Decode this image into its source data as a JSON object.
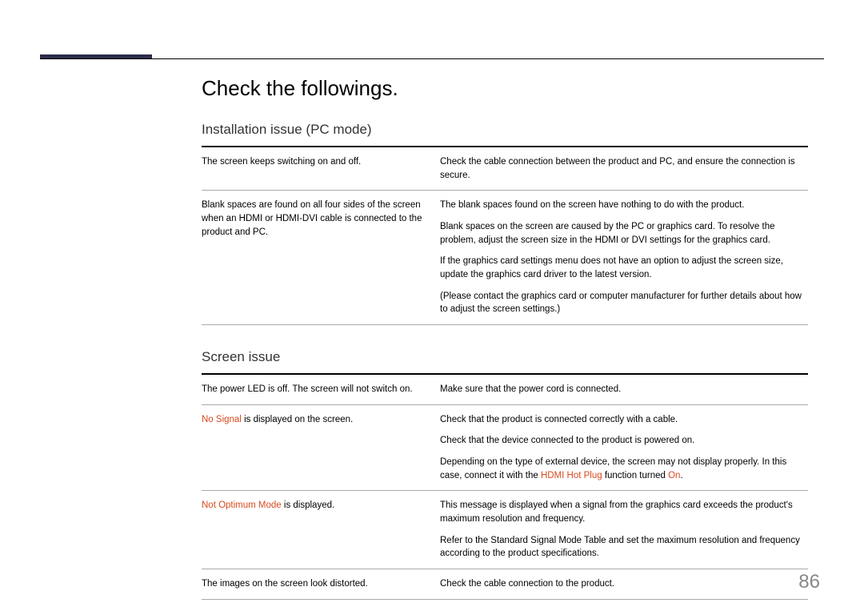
{
  "title": "Check the followings.",
  "section1": {
    "heading": "Installation issue (PC mode)",
    "rows": [
      {
        "left": "The screen keeps switching on and off.",
        "right": [
          "Check the cable connection between the product and PC, and ensure the connection is secure."
        ]
      },
      {
        "left": "Blank spaces are found on all four sides of the screen when an HDMI or HDMI-DVI cable is connected to the product and PC.",
        "right": [
          "The blank spaces found on the screen have nothing to do with the product.",
          "Blank spaces on the screen are caused by the PC or graphics card. To resolve the problem, adjust the screen size in the HDMI or DVI settings for the graphics card.",
          "If the graphics card settings menu does not have an option to adjust the screen size, update the graphics card driver to the latest version.",
          "(Please contact the graphics card or computer manufacturer for further details about how to adjust the screen settings.)"
        ]
      }
    ]
  },
  "section2": {
    "heading": "Screen issue",
    "rows": [
      {
        "left_plain": "The power LED is off. The screen will not switch on.",
        "right": [
          "Make sure that the power cord is connected."
        ]
      },
      {
        "left_red": "No Signal",
        "left_rest": " is displayed on the screen.",
        "right_mixed": {
          "p1": "Check that the product is connected correctly with a cable.",
          "p2": "Check that the device connected to the product is powered on.",
          "p3_a": "Depending on the type of external device, the screen may not display properly. In this case, connect it with the ",
          "p3_red1": "HDMI Hot Plug",
          "p3_b": " function turned ",
          "p3_red2": "On",
          "p3_c": "."
        }
      },
      {
        "left_red": "Not Optimum Mode",
        "left_rest": " is displayed.",
        "right": [
          "This message is displayed when a signal from the graphics card exceeds the product's maximum resolution and frequency.",
          "Refer to the Standard Signal Mode Table and set the maximum resolution and frequency according to the product specifications."
        ]
      },
      {
        "left_plain": "The images on the screen look distorted.",
        "right": [
          "Check the cable connection to the product."
        ]
      }
    ]
  },
  "page_number": "86"
}
